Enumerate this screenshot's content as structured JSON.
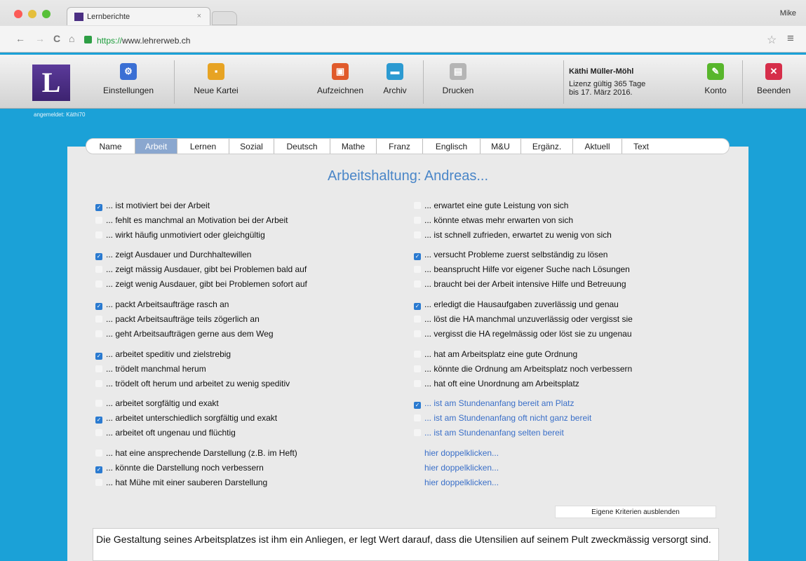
{
  "browser": {
    "tab_title": "Lernberichte",
    "tab_close": "×",
    "user": "Mike",
    "url_scheme": "https://",
    "url_host": "www.lehrerweb.ch",
    "back": "←",
    "forward": "→",
    "reload": "C",
    "home": "⌂",
    "star": "☆",
    "menu": "≡"
  },
  "toolbar": {
    "settings": "Einstellungen",
    "new_card": "Neue Kartei",
    "record": "Aufzeichnen",
    "archive": "Archiv",
    "print": "Drucken",
    "license_name": "Käthi Müller-Möhl",
    "license_line1": "Lizenz gültig 365 Tage",
    "license_line2": "bis 17. März 2016.",
    "account": "Konto",
    "quit": "Beenden",
    "logo_letter": "L"
  },
  "logged_in": "angemeldet: Käthi70",
  "tabs": [
    "Name",
    "Arbeit",
    "Lernen",
    "Sozial",
    "Deutsch",
    "Mathe",
    "Franz",
    "Englisch",
    "M&U",
    "Ergänz.",
    "Aktuell",
    "Text"
  ],
  "active_tab": "Arbeit",
  "heading": "Arbeitshaltung: Andreas...",
  "left_items": [
    {
      "text": "... ist motiviert bei der Arbeit",
      "checked": true
    },
    {
      "text": "... fehlt es manchmal an Motivation bei der Arbeit",
      "checked": false
    },
    {
      "text": "... wirkt häufig unmotiviert oder gleichgültig",
      "checked": false
    },
    {
      "text": "... zeigt Ausdauer und Durchhaltewillen",
      "checked": true
    },
    {
      "text": "... zeigt mässig Ausdauer, gibt bei Problemen bald auf",
      "checked": false
    },
    {
      "text": "... zeigt wenig Ausdauer, gibt bei Problemen sofort auf",
      "checked": false
    },
    {
      "text": "... packt Arbeitsaufträge rasch an",
      "checked": true
    },
    {
      "text": "... packt Arbeitsaufträge teils zögerlich an",
      "checked": false
    },
    {
      "text": "... geht Arbeitsaufträgen gerne aus dem Weg",
      "checked": false
    },
    {
      "text": "... arbeitet speditiv und zielstrebig",
      "checked": true
    },
    {
      "text": "... trödelt manchmal herum",
      "checked": false
    },
    {
      "text": "... trödelt oft herum und arbeitet zu wenig speditiv",
      "checked": false
    },
    {
      "text": "... arbeitet sorgfältig und exakt",
      "checked": false
    },
    {
      "text": "... arbeitet unterschiedlich sorgfältig und exakt",
      "checked": true
    },
    {
      "text": "... arbeitet oft ungenau und flüchtig",
      "checked": false
    },
    {
      "text": "... hat eine ansprechende Darstellung (z.B. im Heft)",
      "checked": false
    },
    {
      "text": "... könnte die Darstellung noch verbessern",
      "checked": true
    },
    {
      "text": "... hat Mühe mit einer sauberen Darstellung",
      "checked": false
    }
  ],
  "right_items": [
    {
      "text": "... erwartet eine gute Leistung von sich",
      "checked": false
    },
    {
      "text": "... könnte etwas mehr erwarten von sich",
      "checked": false
    },
    {
      "text": "... ist schnell zufrieden, erwartet zu wenig von sich",
      "checked": false
    },
    {
      "text": "... versucht Probleme zuerst selbständig zu lösen",
      "checked": true
    },
    {
      "text": "... beansprucht Hilfe vor eigener Suche nach Lösungen",
      "checked": false
    },
    {
      "text": "... braucht bei der Arbeit intensive Hilfe und Betreuung",
      "checked": false
    },
    {
      "text": "... erledigt die Hausaufgaben zuverlässig und genau",
      "checked": true
    },
    {
      "text": "... löst die HA manchmal unzuverlässig oder vergisst sie",
      "checked": false
    },
    {
      "text": "... vergisst die HA regelmässig oder löst sie zu ungenau",
      "checked": false
    },
    {
      "text": "... hat am Arbeitsplatz eine gute Ordnung",
      "checked": false
    },
    {
      "text": "... könnte die Ordnung am Arbeitsplatz noch verbessern",
      "checked": false
    },
    {
      "text": "... hat oft eine Unordnung am Arbeitsplatz",
      "checked": false
    },
    {
      "text": "... ist am Stundenanfang bereit am Platz",
      "checked": true
    },
    {
      "text": "... ist am Stundenanfang oft nicht ganz bereit",
      "checked": false
    },
    {
      "text": "... ist am Stundenanfang selten bereit",
      "checked": false
    },
    {
      "text": "hier doppelklicken..."
    },
    {
      "text": "hier doppelklicken..."
    },
    {
      "text": "hier doppelklicken..."
    }
  ],
  "hide_button": "Eigene Kriterien ausblenden",
  "comment": "Die Gestaltung seines Arbeitsplatzes ist ihm ein Anliegen, er legt Wert darauf, dass die Utensilien auf seinem Pult zweckmässig versorgt sind.",
  "colors": {
    "background": "#1ba1d7",
    "heading": "#4a86c8",
    "checkbox": "#2a7ad0",
    "active_tab": "#8aa7cf"
  }
}
